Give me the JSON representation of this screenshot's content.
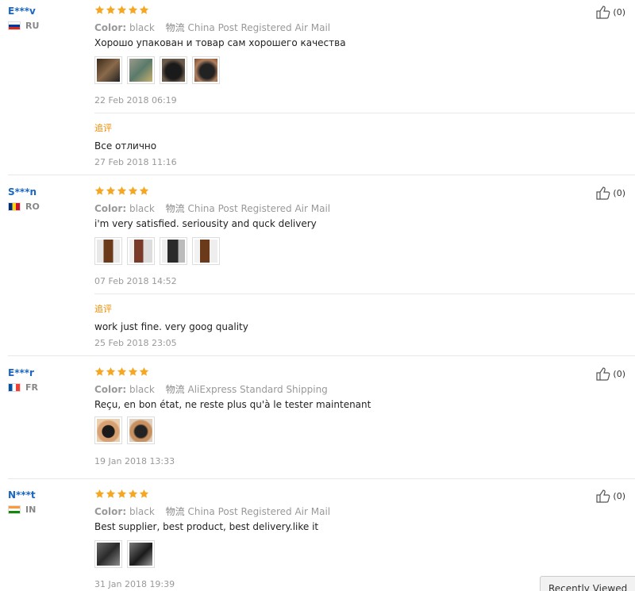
{
  "reviews": [
    {
      "user": "E***v",
      "country": "RU",
      "color_label": "Color:",
      "color_value": "black",
      "shipping_label": "物流",
      "shipping_value": "China Post Registered Air Mail",
      "text": "Хорошо упакован и товар сам хорошего качества",
      "date": "22 Feb 2018 06:19",
      "additional_label": "追评",
      "additional_text": "Все отлично",
      "additional_date": "27 Feb 2018 11:16",
      "helpful_count": "(0)"
    },
    {
      "user": "S***n",
      "country": "RO",
      "color_label": "Color:",
      "color_value": "black",
      "shipping_label": "物流",
      "shipping_value": "China Post Registered Air Mail",
      "text": "i'm very satisfied. seriousity and quck delivery",
      "date": "07 Feb 2018 14:52",
      "additional_label": "追评",
      "additional_text": "work just fine. very goog quality",
      "additional_date": "25 Feb 2018 23:05",
      "helpful_count": "(0)"
    },
    {
      "user": "E***r",
      "country": "FR",
      "color_label": "Color:",
      "color_value": "black",
      "shipping_label": "物流",
      "shipping_value": "AliExpress Standard Shipping",
      "text": "Reçu, en bon état, ne reste plus qu'à le tester maintenant",
      "date": "19 Jan 2018 13:33",
      "helpful_count": "(0)"
    },
    {
      "user": "N***t",
      "country": "IN",
      "color_label": "Color:",
      "color_value": "black",
      "shipping_label": "物流",
      "shipping_value": "China Post Registered Air Mail",
      "text": "Best supplier, best product, best delivery.like it",
      "date": "31 Jan 2018 19:39",
      "helpful_count": "(0)"
    }
  ],
  "recently_viewed": "Recently Viewed",
  "colors": {
    "link_blue": "#1a66c2",
    "star": "#f5a623",
    "additional": "#f18c00"
  }
}
